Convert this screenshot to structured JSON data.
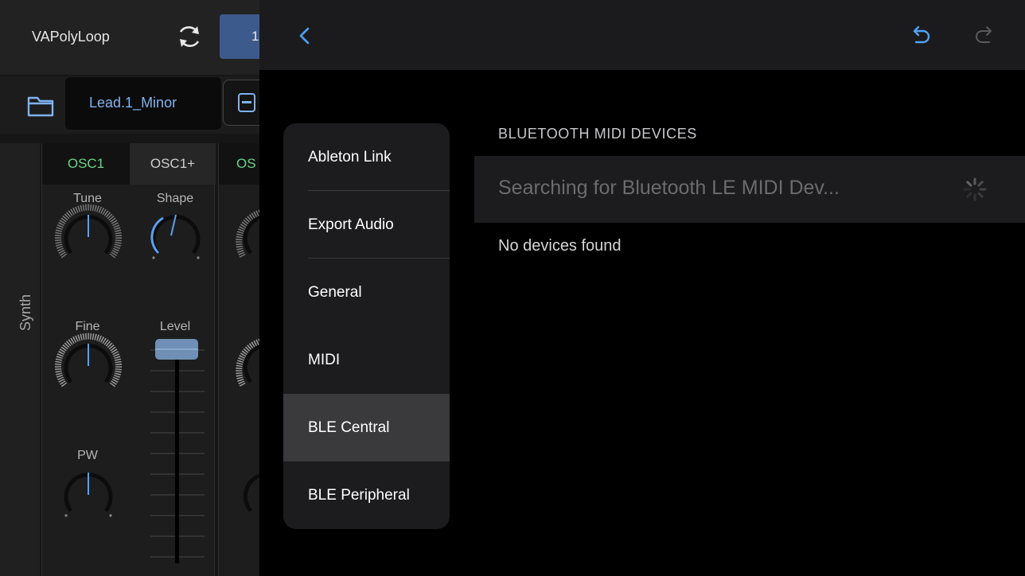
{
  "synth": {
    "app_name": "VAPolyLoop",
    "slot_number": "1",
    "preset_name": "Lead.1_Minor",
    "section_label": "Synth",
    "tabs": [
      "OSC1",
      "OSC1+",
      "OS"
    ],
    "knobs": {
      "tune": "Tune",
      "shape": "Shape",
      "fine": "Fine",
      "pw": "PW",
      "level": "Level"
    },
    "colors": {
      "accent_green": "#6ad38a",
      "accent_blue": "#7fb2f0"
    }
  },
  "settings": {
    "icons": {
      "back": "chevron-left-icon",
      "undo": "undo-icon",
      "redo": "redo-icon"
    },
    "menu": [
      {
        "label": "Ableton Link",
        "selected": false
      },
      {
        "label": "Export Audio",
        "selected": false
      },
      {
        "label": "General",
        "selected": false
      },
      {
        "label": "MIDI",
        "selected": false
      },
      {
        "label": "BLE Central",
        "selected": true
      },
      {
        "label": "BLE Peripheral",
        "selected": false
      }
    ],
    "section_header": "BLUETOOTH MIDI DEVICES",
    "search_status": "Searching for Bluetooth LE MIDI Dev...",
    "empty_message": "No devices found",
    "colors": {
      "accent": "#4fa3f7",
      "selected_row": "#3a3a3c"
    }
  }
}
